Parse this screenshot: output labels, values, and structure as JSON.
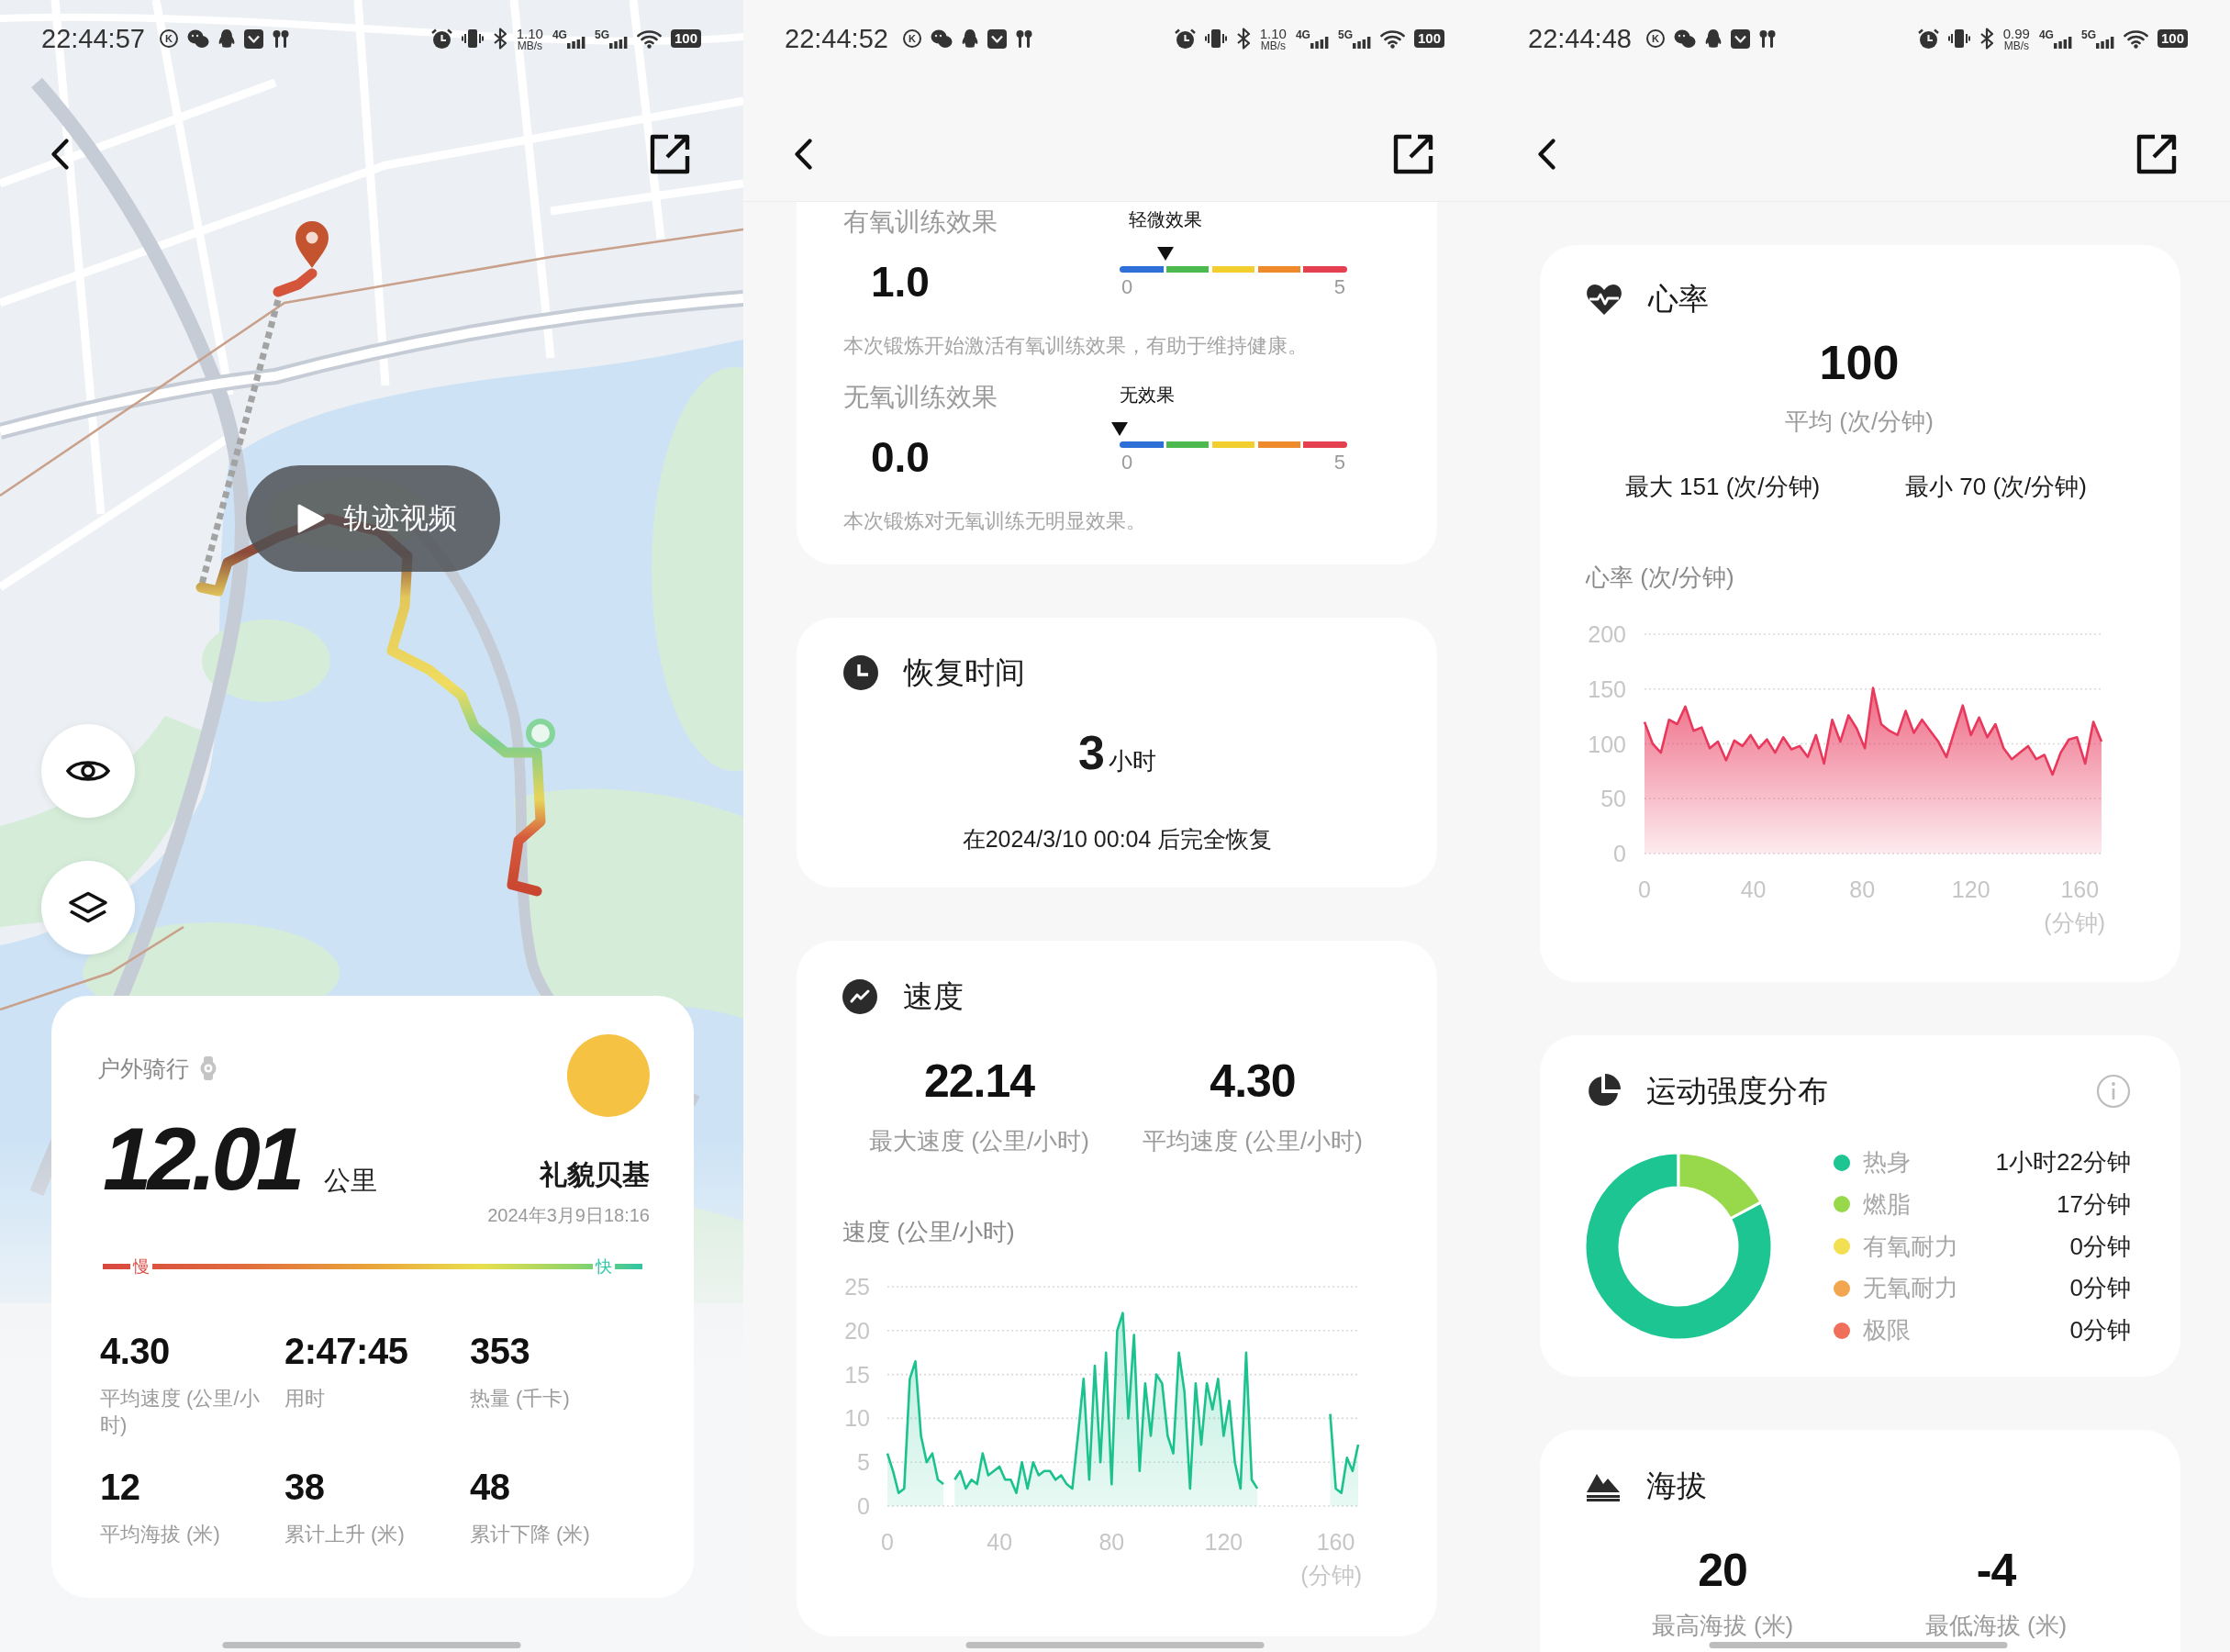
{
  "screens": [
    {
      "kind": "route_map",
      "status_bar": {
        "time": "22:44:57",
        "app_badge": "K",
        "net_speed": "1.10",
        "net_unit": "MB/s",
        "networks": [
          "4G",
          "5G"
        ],
        "battery": "100"
      },
      "video_button": "轨迹视频",
      "activity": {
        "sport": "户外骑行",
        "distance": "12.01",
        "distance_unit": "公里",
        "user_name": "礼貌贝基",
        "date": "2024年3月9日18:16",
        "scale_slow": "慢",
        "scale_fast": "快",
        "stats": [
          {
            "value": "4.30",
            "label": "平均速度 (公里/小时)"
          },
          {
            "value": "2:47:45",
            "label": "用时"
          },
          {
            "value": "353",
            "label": "热量 (千卡)"
          },
          {
            "value": "12",
            "label": "平均海拔 (米)"
          },
          {
            "value": "38",
            "label": "累计上升 (米)"
          },
          {
            "value": "48",
            "label": "累计下降 (米)"
          }
        ]
      }
    },
    {
      "kind": "details",
      "status_bar": {
        "time": "22:44:52",
        "app_badge": "K",
        "net_speed": "1.10",
        "net_unit": "MB/s",
        "networks": [
          "4G",
          "5G"
        ],
        "battery": "100"
      },
      "cards": [
        {
          "kind": "training_effect",
          "items": [
            {
              "title": "有氧训练效果",
              "value": "1.0",
              "rating": "轻微效果",
              "level": 0.2,
              "scale_min": "0",
              "scale_max": "5",
              "note": "本次锻炼开始激活有氧训练效果，有助于维持健康。"
            },
            {
              "title": "无氧训练效果",
              "value": "0.0",
              "rating": "无效果",
              "level": 0,
              "scale_min": "0",
              "scale_max": "5",
              "note": "本次锻炼对无氧训练无明显效果。"
            }
          ]
        },
        {
          "kind": "recovery",
          "title": "恢复时间",
          "value": "3",
          "unit": "小时",
          "note": "在2024/3/10 00:04 后完全恢复"
        },
        {
          "kind": "speed",
          "title": "速度",
          "metrics": [
            {
              "value": "22.14",
              "label": "最大速度 (公里/小时)"
            },
            {
              "value": "4.30",
              "label": "平均速度 (公里/小时)"
            }
          ],
          "chart_data": {
            "type": "area",
            "ylabel": "速度 (公里/小时)",
            "xlabel": "(分钟)",
            "grid": true,
            "x": [
              0,
              2,
              4,
              6,
              8,
              10,
              12,
              14,
              16,
              18,
              20,
              22,
              24,
              26,
              28,
              30,
              32,
              34,
              36,
              38,
              40,
              42,
              44,
              46,
              48,
              50,
              52,
              54,
              56,
              58,
              60,
              62,
              64,
              66,
              68,
              70,
              72,
              74,
              76,
              78,
              80,
              82,
              84,
              86,
              88,
              90,
              92,
              94,
              96,
              98,
              100,
              102,
              104,
              106,
              108,
              110,
              112,
              114,
              116,
              118,
              120,
              122,
              124,
              126,
              128,
              130,
              132,
              134,
              136,
              138,
              140,
              142,
              144,
              146,
              148,
              150,
              152,
              154,
              156,
              158,
              160,
              162,
              164,
              166,
              168
            ],
            "series": [
              {
                "color": "#1bc28e",
                "values": [
                  6,
                  4,
                  1.5,
                  2,
                  14.5,
                  16.5,
                  8,
                  5,
                  6,
                  3,
                  2.5,
                  null,
                  3,
                  4,
                  2,
                  3,
                  2.5,
                  6,
                  3.5,
                  4,
                  4.5,
                  3,
                  3,
                  1.5,
                  5,
                  2,
                  5,
                  3.5,
                  4,
                  4,
                  3,
                  3.5,
                  2.5,
                  2,
                  8,
                  14.5,
                  3,
                  16,
                  5,
                  17.5,
                  2.5,
                  20,
                  22,
                  10,
                  19.5,
                  4,
                  14,
                  8,
                  15,
                  14,
                  8,
                  6,
                  17.5,
                  13,
                  2,
                  14,
                  7,
                  14,
                  11,
                  14.5,
                  8,
                  12,
                  5,
                  2,
                  17.5,
                  3,
                  2,
                  null,
                  null,
                  null,
                  null,
                  null,
                  null,
                  null,
                  null,
                  null,
                  null,
                  null,
                  null,
                  10.5,
                  2,
                  1.5,
                  5.5,
                  4,
                  7
                ]
              }
            ],
            "xlim": [
              0,
              168
            ],
            "ylim": [
              0,
              25
            ],
            "xticks": [
              0,
              40,
              80,
              120,
              160
            ],
            "yticks": [
              0,
              5,
              10,
              15,
              20,
              25
            ]
          }
        }
      ]
    },
    {
      "kind": "details",
      "status_bar": {
        "time": "22:44:48",
        "app_badge": "K",
        "net_speed": "0.99",
        "net_unit": "MB/s",
        "networks": [
          "4G",
          "5G"
        ],
        "battery": "100"
      },
      "cards": [
        {
          "kind": "heart_rate",
          "title": "心率",
          "value": "100",
          "value_label": "平均 (次/分钟)",
          "extremes": [
            "最大 151 (次/分钟)",
            "最小 70 (次/分钟)"
          ],
          "chart_data": {
            "type": "area",
            "ylabel": "心率 (次/分钟)",
            "xlabel": "(分钟)",
            "grid": true,
            "x": [
              0,
              3,
              6,
              9,
              12,
              15,
              18,
              21,
              24,
              27,
              30,
              33,
              36,
              39,
              42,
              45,
              48,
              51,
              54,
              57,
              60,
              63,
              66,
              69,
              72,
              75,
              78,
              81,
              84,
              87,
              90,
              93,
              96,
              99,
              102,
              105,
              108,
              111,
              114,
              117,
              120,
              123,
              126,
              129,
              132,
              135,
              138,
              141,
              144,
              147,
              150,
              153,
              156,
              159,
              162,
              165,
              168
            ],
            "series": [
              {
                "color": "#e8385c",
                "values": [
                  120,
                  100,
                  92,
                  122,
                  118,
                  134,
                  112,
                  115,
                  96,
                  102,
                  85,
                  103,
                  98,
                  108,
                  96,
                  104,
                  92,
                  106,
                  95,
                  98,
                  88,
                  108,
                  82,
                  122,
                  102,
                  126,
                  114,
                  96,
                  151,
                  118,
                  112,
                  108,
                  130,
                  110,
                  122,
                  112,
                  102,
                  88,
                  112,
                  135,
                  108,
                  124,
                  106,
                  118,
                  96,
                  86,
                  92,
                  98,
                  86,
                  90,
                  72,
                  92,
                  104,
                  106,
                  82,
                  120,
                  102
                ]
              }
            ],
            "xlim": [
              0,
              168
            ],
            "ylim": [
              0,
              200
            ],
            "xticks": [
              0,
              40,
              80,
              120,
              160
            ],
            "yticks": [
              0,
              50,
              100,
              150,
              200
            ]
          }
        },
        {
          "kind": "intensity",
          "title": "运动强度分布",
          "zones": [
            {
              "color": "#1dc593",
              "duration": "1小时22分钟"
            },
            {
              "color": "#98d94c",
              "duration": "17分钟"
            },
            {
              "color": "#f2df52",
              "duration": "0分钟"
            },
            {
              "color": "#f2a650",
              "duration": "0分钟"
            },
            {
              "color": "#ef6f5a",
              "duration": "0分钟"
            }
          ],
          "chart_data": {
            "type": "donut",
            "categories": [
              "热身",
              "燃脂",
              "有氧耐力",
              "无氧耐力",
              "极限"
            ],
            "values": [
              82,
              17,
              0,
              0,
              0
            ]
          }
        },
        {
          "kind": "altitude",
          "title": "海拔",
          "metrics": [
            {
              "value": "20",
              "label": "最高海拔 (米)"
            },
            {
              "value": "-4",
              "label": "最低海拔 (米)"
            }
          ]
        }
      ]
    }
  ]
}
